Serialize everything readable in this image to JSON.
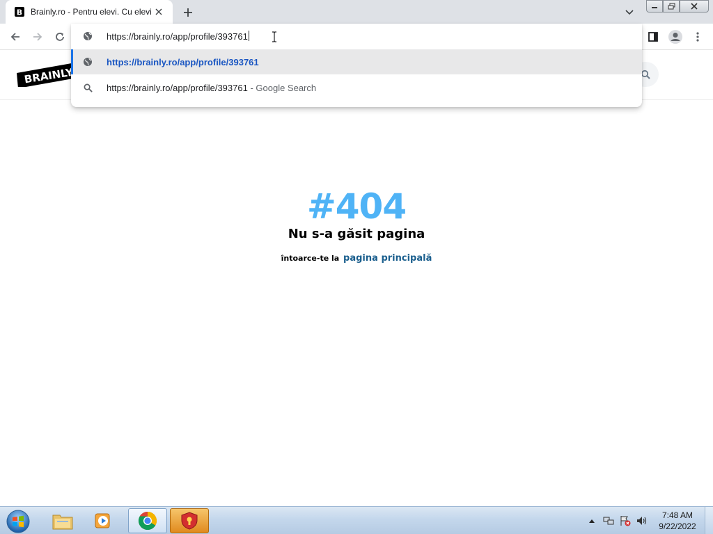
{
  "browser": {
    "tab": {
      "title": "Brainly.ro - Pentru elevi. Cu elevi.",
      "favicon": "brainly-b-icon"
    },
    "omnibox": {
      "value": "https://brainly.ro/app/profile/393761",
      "suggestions": [
        {
          "icon": "globe-icon",
          "url": "https://brainly.ro/app/profile/393761"
        },
        {
          "icon": "search-icon",
          "text": "https://brainly.ro/app/profile/393761",
          "suffix": " - Google Search"
        }
      ]
    }
  },
  "site": {
    "logo_text": "BRAINLY",
    "error": {
      "code": "#404",
      "title": "Nu s-a găsit pagina",
      "back_text": "întoarce-te la",
      "back_link": "pagina principală"
    }
  },
  "taskbar": {
    "apps": [
      "file-explorer-icon",
      "media-player-icon",
      "chrome-icon",
      "security-shield-icon"
    ],
    "clock": {
      "time": "7:48 AM",
      "date": "9/22/2022"
    }
  },
  "colors": {
    "accent_blue": "#4fb3f6",
    "link_blue": "#1b5f8e",
    "omnibox_url": "#1a56c2",
    "highlight_bar": "#1a73e8"
  }
}
